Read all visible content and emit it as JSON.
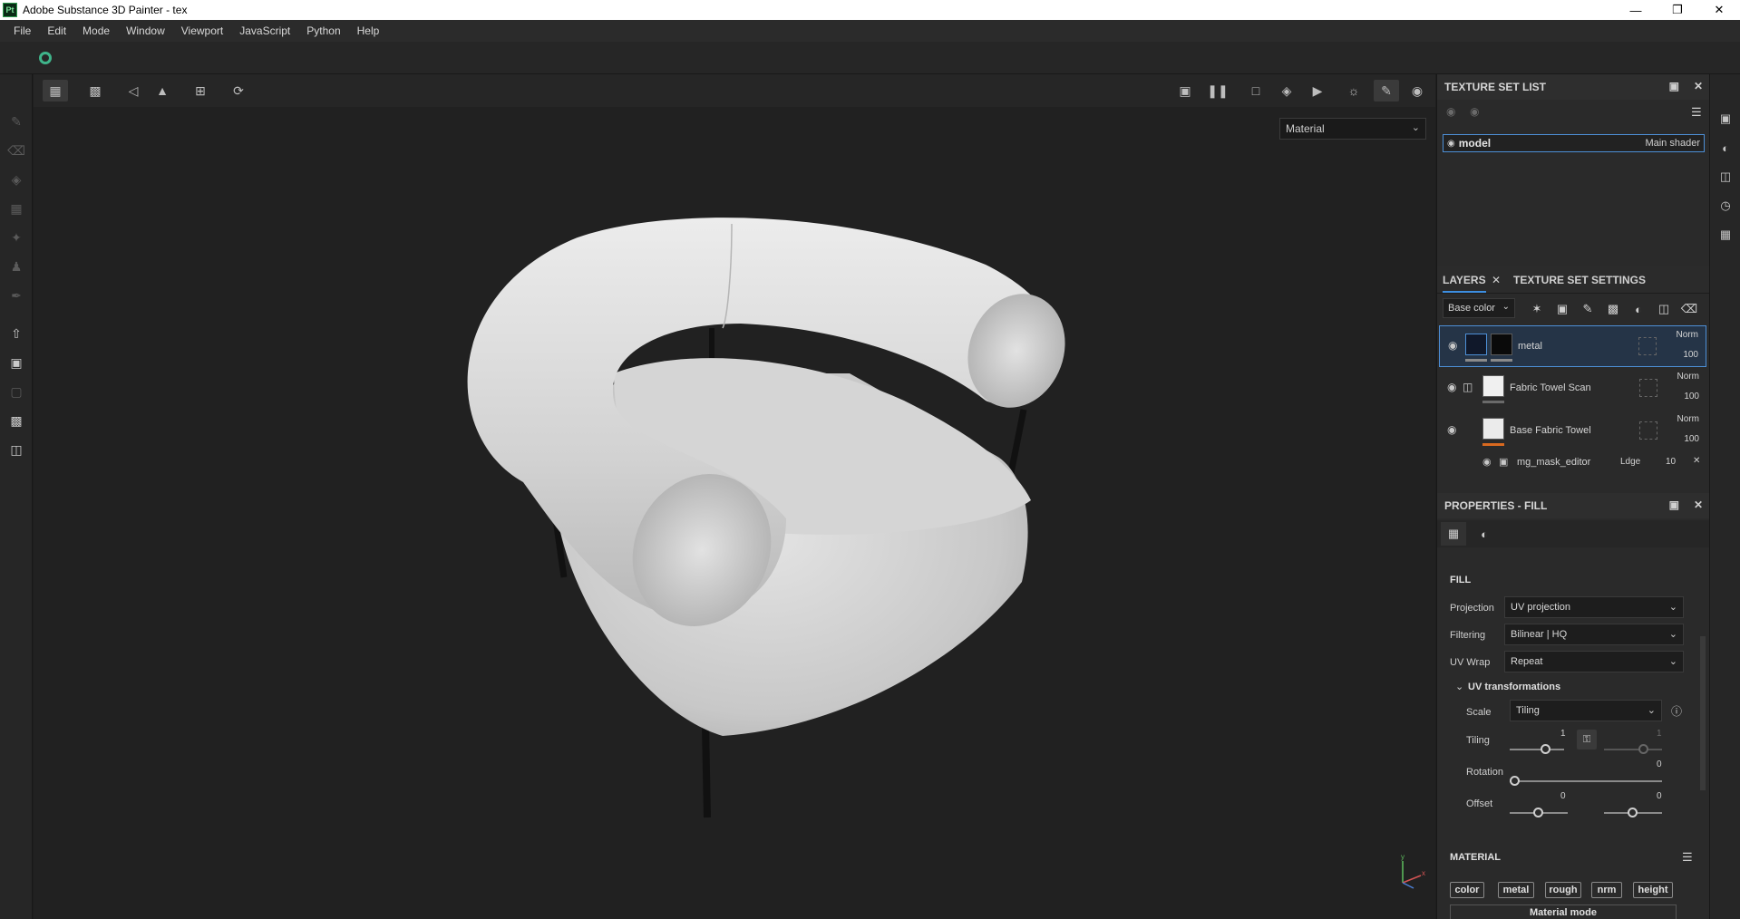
{
  "window": {
    "app_icon": "Pt",
    "title": "Adobe Substance 3D Painter - tex"
  },
  "menu": [
    "File",
    "Edit",
    "Mode",
    "Window",
    "Viewport",
    "JavaScript",
    "Python",
    "Help"
  ],
  "viewport": {
    "display_mode": "Material"
  },
  "texture_set_list": {
    "title": "TEXTURE SET LIST",
    "items": [
      {
        "name": "model",
        "shader": "Main shader"
      }
    ]
  },
  "layers_panel": {
    "tabs": [
      "LAYERS",
      "TEXTURE SET SETTINGS"
    ],
    "channel": "Base color",
    "layers": [
      {
        "name": "metal",
        "blend": "Norm",
        "opacity": "100",
        "selected": true,
        "underline_color": "#8a8a8a"
      },
      {
        "name": "Fabric Towel Scan",
        "blend": "Norm",
        "opacity": "100",
        "selected": false,
        "underline_color": "#6a6a6a"
      },
      {
        "name": "Base Fabric Towel",
        "blend": "Norm",
        "opacity": "100",
        "selected": false,
        "underline_color": "#d9691f"
      }
    ],
    "effect": {
      "name": "mg_mask_editor",
      "blend": "Ldge",
      "opacity": "10"
    }
  },
  "properties": {
    "title": "PROPERTIES - FILL",
    "section": "FILL",
    "projection_label": "Projection",
    "projection": "UV projection",
    "filtering_label": "Filtering",
    "filtering": "Bilinear | HQ",
    "uvwrap_label": "UV Wrap",
    "uvwrap": "Repeat",
    "uvt_label": "UV transformations",
    "scale_label": "Scale",
    "scale": "Tiling",
    "tiling_label": "Tiling",
    "tiling_u": "1",
    "tiling_v": "1",
    "rotation_label": "Rotation",
    "rotation": "0",
    "offset_label": "Offset",
    "offset_u": "0",
    "offset_v": "0",
    "material_label": "MATERIAL",
    "channels": [
      "color",
      "metal",
      "rough",
      "nrm",
      "height"
    ],
    "material_mode": "Material mode"
  },
  "colors": {
    "accent": "#4d8fd6",
    "sync": "#3fb48a"
  }
}
